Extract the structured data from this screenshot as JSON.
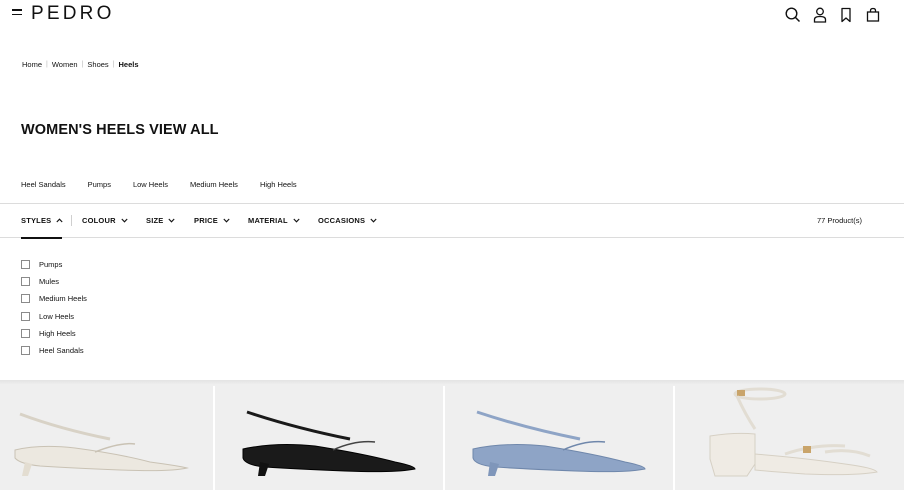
{
  "header": {
    "logo": "PEDRO",
    "icons": [
      "menu-icon",
      "search-icon",
      "account-icon",
      "wishlist-icon",
      "bag-icon"
    ]
  },
  "breadcrumb": {
    "items": [
      "Home",
      "Women",
      "Shoes",
      "Heels"
    ]
  },
  "page_title": "WOMEN'S HEELS VIEW ALL",
  "subcategories": [
    "Heel Sandals",
    "Pumps",
    "Low Heels",
    "Medium Heels",
    "High Heels"
  ],
  "filters": {
    "items": [
      "STYLES",
      "COLOUR",
      "SIZE",
      "PRICE",
      "MATERIAL",
      "OCCASIONS"
    ],
    "active": "STYLES",
    "product_count": "77 Product(s)"
  },
  "style_options": [
    "Pumps",
    "Mules",
    "Medium Heels",
    "Low Heels",
    "High Heels",
    "Heel Sandals"
  ],
  "products": [
    {
      "color": "#ece8e0",
      "kind": "slingback"
    },
    {
      "color": "#1a1a1a",
      "kind": "slingback"
    },
    {
      "color": "#8ea4c6",
      "kind": "slingback"
    },
    {
      "color": "#efebe4",
      "kind": "sandal"
    }
  ]
}
